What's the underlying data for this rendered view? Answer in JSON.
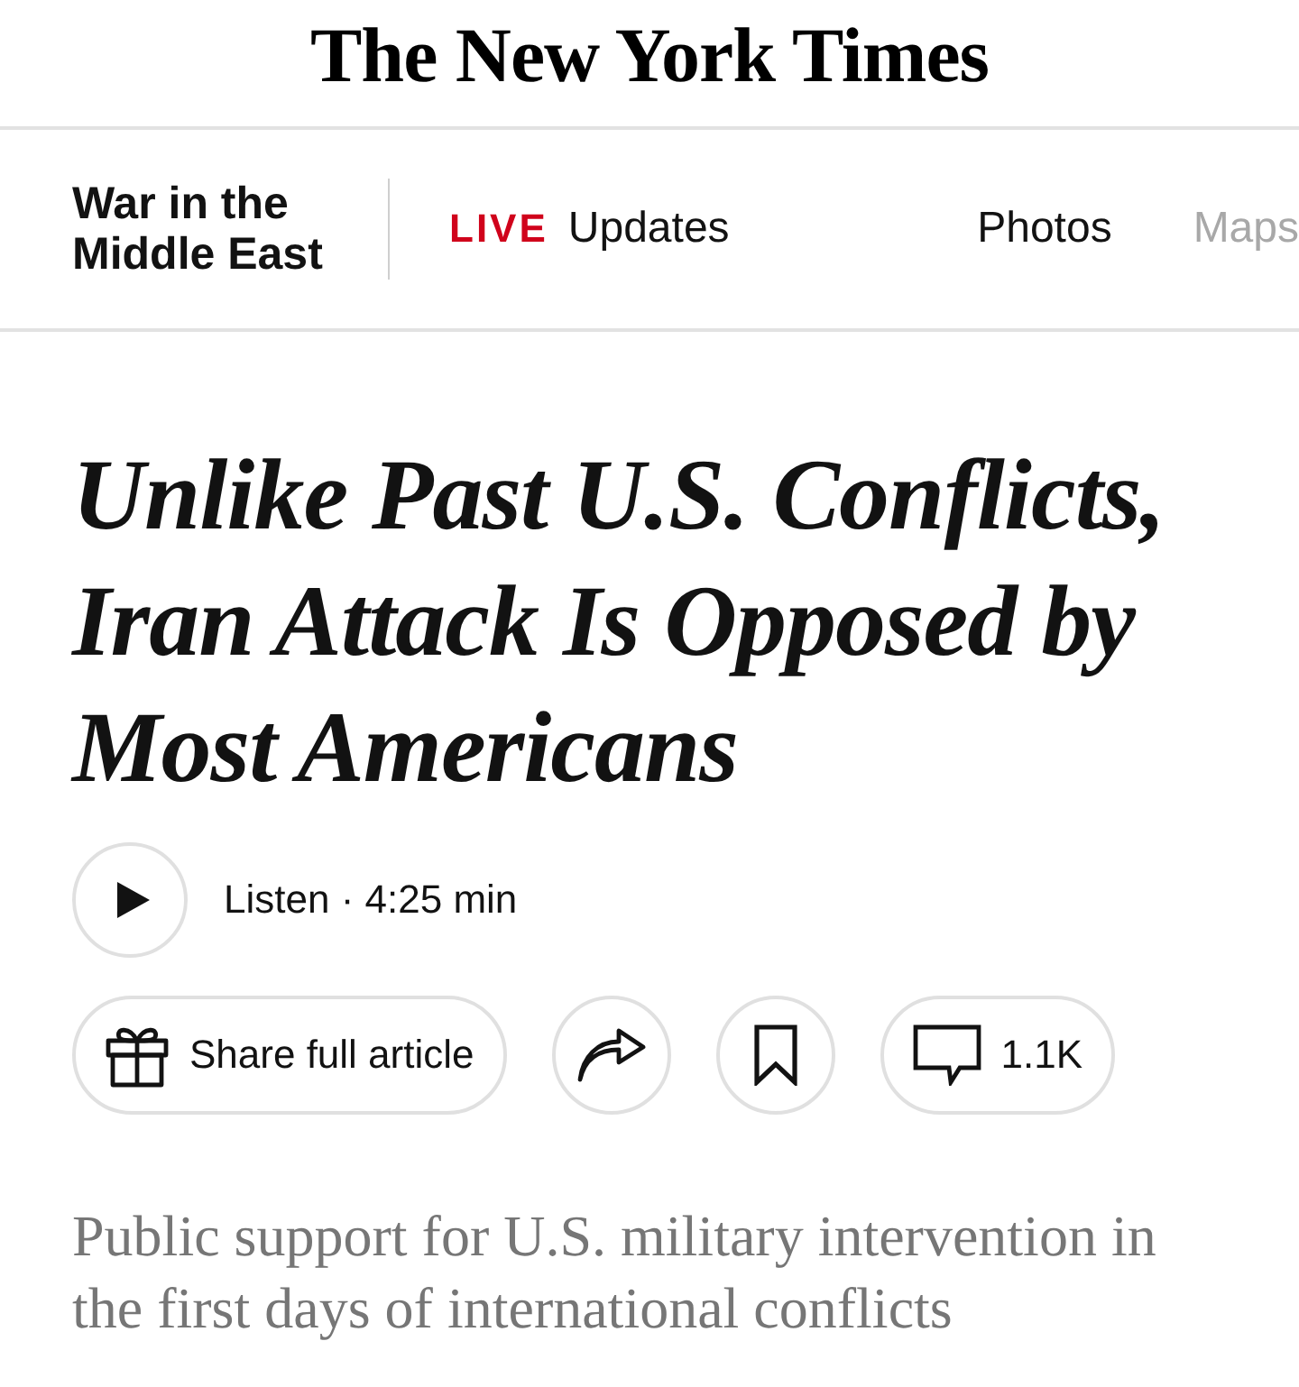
{
  "masthead": {
    "logo": "The New York Times"
  },
  "section_nav": {
    "section_title": "War in the Middle East",
    "items": [
      {
        "kind": "live",
        "badge": "LIVE",
        "label": "Updates",
        "faded": false
      },
      {
        "kind": "link",
        "label": "Photos",
        "faded": false
      },
      {
        "kind": "link",
        "label": "Maps",
        "faded": true
      }
    ]
  },
  "headline": "Unlike Past U.S. Conflicts, Iran Attack Is Opposed by Most Americans",
  "listen": {
    "label": "Listen · 4:25 min"
  },
  "actions": [
    {
      "kind": "gift",
      "label": "Share full article"
    },
    {
      "kind": "share"
    },
    {
      "kind": "bookmark"
    },
    {
      "kind": "comments",
      "label": "1.1K"
    }
  ],
  "summary": "Public support for U.S. military intervention in the first days of international conflicts"
}
